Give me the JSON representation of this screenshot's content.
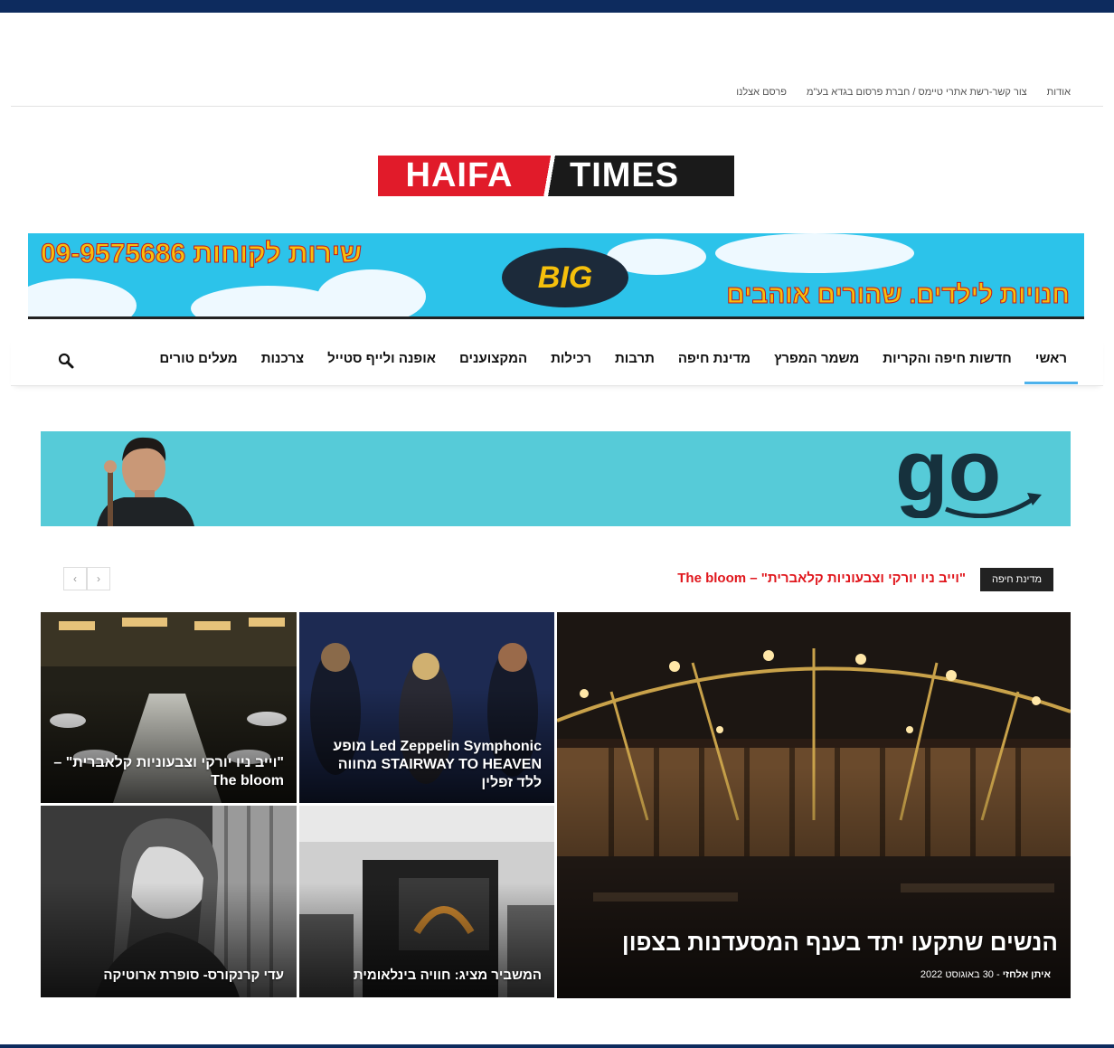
{
  "top_links": [
    "אודות",
    "צור קשר-רשת אתרי טיימס / חברת פרסום בגדא בע\"מ",
    "פרסם אצלנו"
  ],
  "logo": {
    "left": "HAIFA",
    "right": "TIMES"
  },
  "ad_banner": {
    "phone": "09-9575686 שירות לקוחות",
    "slogan": "חנויות לילדים. שהורים אוהבים",
    "brand": "BIG"
  },
  "nav": {
    "items": [
      "ראשי",
      "חדשות חיפה והקריות",
      "משמר המפרץ",
      "מדינת חיפה",
      "תרבות",
      "רכילות",
      "המקצוענים",
      "אופנה ולייף סטייל",
      "צרכנות",
      "מעלים טורים"
    ],
    "active_index": 0
  },
  "go_banner": {
    "brand": "go"
  },
  "ticker": {
    "badge": "מדינת חיפה",
    "headline": "\"וייב ניו יורקי וצבעוניות קלאברית\" – The bloom"
  },
  "tiles": {
    "main": {
      "title": "הנשים שתקעו יתד בענף המסעדנות בצפון",
      "author": "איתן אלחזי",
      "separator": "-",
      "date": "30 באוגוסט 2022"
    },
    "t1": {
      "title": "Led Zeppelin Symphonic מופע STAIRWAY TO HEAVEN מחווה ללד זפלין"
    },
    "t2": {
      "title": "\"וייב ניו יורקי וצבעוניות קלאברית\" – The bloom"
    },
    "t3": {
      "title": "המשביר מציג: חוויה בינלאומית"
    },
    "t4": {
      "title": "עדי קרנקורס- סופרת ארוטיקה"
    }
  }
}
